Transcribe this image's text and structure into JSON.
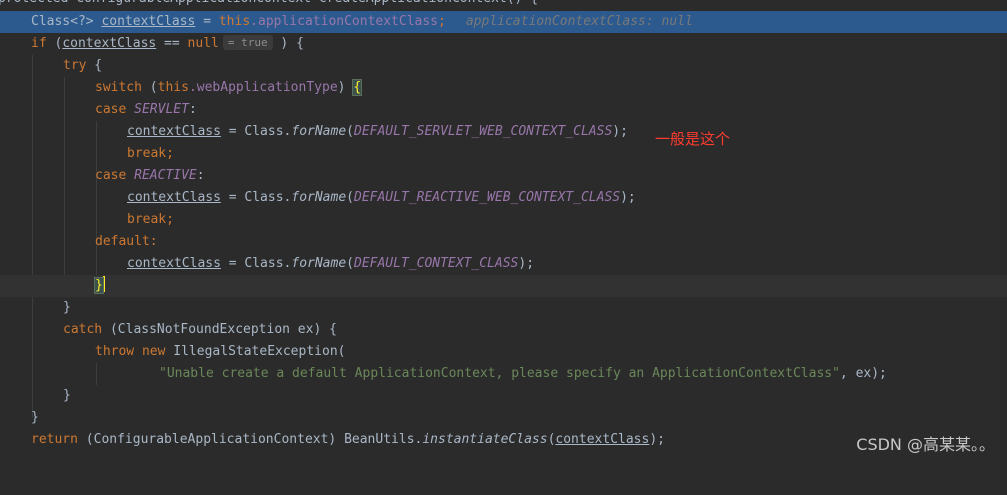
{
  "editor": {
    "method_signature": "protected ConfigurableApplicationContext createApplicationContext() {",
    "lines": {
      "l1_type": "Class<?> ",
      "l1_var": "contextClass",
      "l1_eq": " = ",
      "l1_this": "this",
      "l1_field": ".applicationContextClass",
      "l1_semi": ";",
      "l1_debug": "applicationContextClass: null",
      "l2_if": "if",
      "l2_open": " (",
      "l2_var": "contextClass",
      "l2_cmp": " == ",
      "l2_null": "null",
      "l2_inlay": "= true",
      "l2_close": " ) {",
      "l3_try": "try",
      "l3_brace": " {",
      "l4_switch": "switch",
      "l4_open": " (",
      "l4_this": "this",
      "l4_field": ".webApplicationType",
      "l4_close": ") ",
      "l4_brace": "{",
      "l5_case": "case",
      "l5_enum": "SERVLET",
      "l5_colon": ":",
      "l6_var": "contextClass",
      "l6_eq": " = Class.",
      "l6_method": "forName",
      "l6_open": "(",
      "l6_const": "DEFAULT_SERVLET_WEB_CONTEXT_CLASS",
      "l6_close": ");",
      "l7_break": "break;",
      "l8_case": "case",
      "l8_enum": "REACTIVE",
      "l8_colon": ":",
      "l9_var": "contextClass",
      "l9_eq": " = Class.",
      "l9_method": "forName",
      "l9_open": "(",
      "l9_const": "DEFAULT_REACTIVE_WEB_CONTEXT_CLASS",
      "l9_close": ");",
      "l10_break": "break;",
      "l11_default": "default:",
      "l12_var": "contextClass",
      "l12_eq": " = Class.",
      "l12_method": "forName",
      "l12_open": "(",
      "l12_const": "DEFAULT_CONTEXT_CLASS",
      "l12_close": ");",
      "l13_brace": "}",
      "l14_brace": "}",
      "l15_catch": "catch",
      "l15_rest": " (ClassNotFoundException ex) {",
      "l16_throw": "throw",
      "l16_new": "new",
      "l16_rest": " IllegalStateException(",
      "l17_str": "\"Unable create a default ApplicationContext, please specify an ApplicationContextClass\"",
      "l17_rest": ", ex);",
      "l18_brace": "}",
      "l19_brace": "}",
      "l20_return": "return",
      "l20_cast": " (ConfigurableApplicationContext) BeanUtils.",
      "l20_method": "instantiateClass",
      "l20_open": "(",
      "l20_var": "contextClass",
      "l20_close": ");"
    }
  },
  "annotation": "一般是这个",
  "watermark": "CSDN @高某某。。",
  "colors": {
    "background": "#2b2b2b",
    "execution_line": "#2d5a8e",
    "keyword": "#cc7832",
    "field": "#9876aa",
    "string": "#6a8759",
    "annotation": "#ff3b30"
  }
}
